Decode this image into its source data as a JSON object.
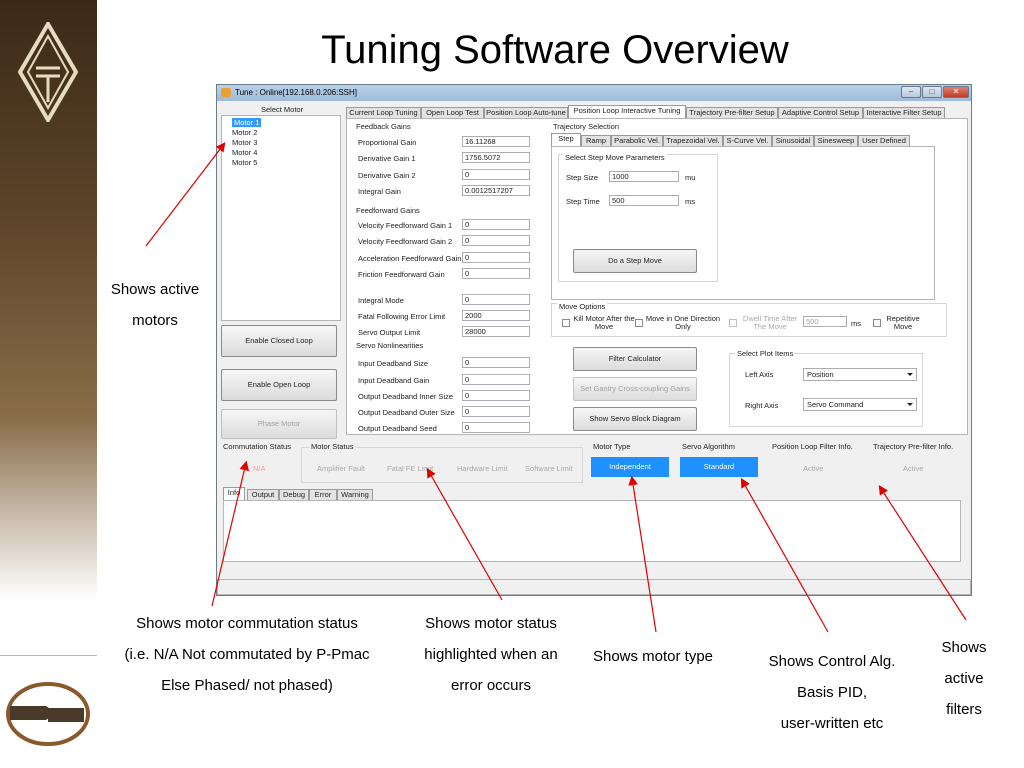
{
  "slide": {
    "title": "Tuning Software Overview",
    "captions": {
      "active_motors": [
        "Shows active",
        "motors"
      ],
      "commutation": [
        "Shows motor commutation status",
        "(i.e. N/A Not commutated by P-Pmac",
        "Else Phased/ not phased)"
      ],
      "motor_status": [
        "Shows motor status",
        "highlighted when an",
        "error occurs"
      ],
      "motor_type": [
        "Shows motor type"
      ],
      "control_alg": [
        "Shows Control Alg.",
        "Basis PID,",
        "user-written etc"
      ],
      "filters": [
        "Shows",
        "active",
        "filters"
      ]
    }
  },
  "window": {
    "title": "Tune : Online[192.168.0.206:SSH]",
    "controls": [
      "–",
      "□",
      "✕"
    ]
  },
  "motor_select": {
    "header": "Select Motor",
    "motors": [
      "Motor 1",
      "Motor 2",
      "Motor 3",
      "Motor 4",
      "Motor 5"
    ],
    "selected": "Motor 1"
  },
  "left_buttons": {
    "closed_loop": "Enable Closed Loop",
    "open_loop": "Enable Open Loop",
    "phase": "Phase Motor"
  },
  "main_tabs": [
    "Current Loop Tuning",
    "Open Loop Test",
    "Position Loop Auto-tune",
    "Position Loop Interactive Tuning",
    "Trajectory Pre-filter Setup",
    "Adaptive Control Setup",
    "Interactive Filter Setup"
  ],
  "main_tab_active": "Position Loop Interactive Tuning",
  "gains": {
    "feedback_title": "Feedback Gains",
    "feedback": [
      {
        "label": "Proportional Gain",
        "value": "16.11268"
      },
      {
        "label": "Derivative Gain 1",
        "value": "1756.5072"
      },
      {
        "label": "Derivative Gain 2",
        "value": "0"
      },
      {
        "label": "Integral Gain",
        "value": "0.0012517207"
      }
    ],
    "feedforward_title": "Feedforward Gains",
    "feedforward": [
      {
        "label": "Velocity Feedforward Gain 1",
        "value": "0"
      },
      {
        "label": "Velocity Feedforward Gain 2",
        "value": "0"
      },
      {
        "label": "Acceleration Feedforward Gain",
        "value": "0"
      },
      {
        "label": "Friction Feedforward Gain",
        "value": "0"
      }
    ],
    "misc": [
      {
        "label": "Integral Mode",
        "value": "0"
      },
      {
        "label": "Fatal Following Error Limit",
        "value": "2000"
      },
      {
        "label": "Servo Output Limit",
        "value": "28000"
      }
    ],
    "nonlin_title": "Servo Nonlinearities",
    "nonlin": [
      {
        "label": "Input Deadband Size",
        "value": "0"
      },
      {
        "label": "Input Deadband Gain",
        "value": "0"
      },
      {
        "label": "Output Deadband Inner Size",
        "value": "0"
      },
      {
        "label": "Output Deadband Outer Size",
        "value": "0"
      },
      {
        "label": "Output Deadband Seed",
        "value": "0"
      }
    ]
  },
  "trajectory": {
    "title": "Trajectory Selection",
    "tabs": [
      "Step",
      "Ramp",
      "Parabolic Vel.",
      "Trapezoidal Vel.",
      "S-Curve Vel.",
      "Sinusoidal",
      "Sinesweep",
      "User Defined"
    ],
    "active_tab": "Step",
    "params_title": "Select Step Move Parameters",
    "step_size_label": "Step Size",
    "step_size": "1000",
    "step_size_unit": "mu",
    "step_time_label": "Step Time",
    "step_time": "500",
    "step_time_unit": "ms",
    "do_move": "Do a Step Move"
  },
  "move_options": {
    "title": "Move Options",
    "kill_motor": "Kill Motor After the Move",
    "one_direction": "Move in One Direction Only",
    "dwell": "Dwell Time After The Move",
    "dwell_value": "500",
    "dwell_unit": "ms",
    "repetitive": "Repetitive Move"
  },
  "tools": {
    "filter_calc": "Filter Calculator",
    "gantry": "Set Gantry Cross-coupling Gains",
    "servo_block": "Show Servo Block Diagram"
  },
  "plot": {
    "title": "Select Plot Items",
    "left_label": "Left Axis",
    "left_value": "Position",
    "right_label": "Right Axis",
    "right_value": "Servo Command"
  },
  "status": {
    "commutation_label": "Commutation Status",
    "commutation_value": "N/A",
    "motor_status_label": "Motor Status",
    "motor_status_items": [
      "Amplifier Fault",
      "Fatal FE Limit",
      "Hardware Limit",
      "Software Limit"
    ],
    "motor_type_label": "Motor Type",
    "motor_type_value": "Independent",
    "servo_alg_label": "Servo Algorithm",
    "servo_alg_value": "Standard",
    "pos_filter_label": "Position Loop Filter Info.",
    "pos_filter_value": "Active",
    "traj_filter_label": "Trajectory Pre-filter Info.",
    "traj_filter_value": "Active"
  },
  "bottom_tabs": [
    "Info",
    "Output",
    "Debug",
    "Error",
    "Warning"
  ],
  "colors": {
    "highlight": "#1e90ff",
    "arrow": "#e00000",
    "status_alert": "#ff9a9a"
  }
}
